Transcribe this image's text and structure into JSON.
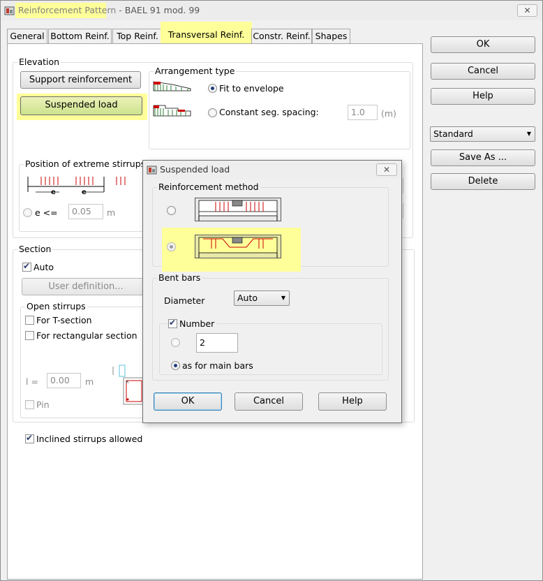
{
  "window": {
    "title_app": "Reinforcement Pattern",
    "title_sep": " - ",
    "title_doc": "BAEL 91 mod. 99",
    "close_glyph": "✕"
  },
  "tabs": [
    {
      "label": "General"
    },
    {
      "label": "Bottom Reinf."
    },
    {
      "label": "Top Reinf."
    },
    {
      "label": "Transversal Reinf."
    },
    {
      "label": "Constr. Reinf."
    },
    {
      "label": "Shapes"
    }
  ],
  "right_panel": {
    "ok": "OK",
    "cancel": "Cancel",
    "help": "Help",
    "preset": "Standard",
    "save_as": "Save As ...",
    "delete": "Delete"
  },
  "elevation": {
    "title": "Elevation",
    "support_button": "Support reinforcement",
    "suspended_button": "Suspended load",
    "arrangement": {
      "title": "Arrangement type",
      "fit_label": "Fit to envelope",
      "constant_label": "Constant seg. spacing:",
      "constant_value": "1.0",
      "constant_unit": "(m)"
    },
    "extreme": {
      "title": "Position of extreme stirrups",
      "e_label": "e",
      "radio_label": "e <=",
      "value": "0.05",
      "unit": "m"
    }
  },
  "section": {
    "title": "Section",
    "auto_label": "Auto",
    "user_def": "User definition...",
    "open_stirrups": {
      "title": "Open stirrups",
      "t_section": "For T-section",
      "rect_section": "For rectangular section",
      "l_label": "l =",
      "l_value": "0.00",
      "l_unit": "m",
      "pin_label": "Pin"
    }
  },
  "inclined_label": "Inclined stirrups allowed",
  "dialog": {
    "title": "Suspended load",
    "close_glyph": "✕",
    "method_title": "Reinforcement method",
    "bent_title": "Bent bars",
    "diameter_label": "Diameter",
    "diameter_value": "Auto",
    "number_label": "Number",
    "number_value": "2",
    "as_main_label": "as for main bars",
    "ok": "OK",
    "cancel": "Cancel",
    "help": "Help"
  },
  "colors": {
    "highlight": "#ffff99",
    "active_button": "#cce38d"
  }
}
